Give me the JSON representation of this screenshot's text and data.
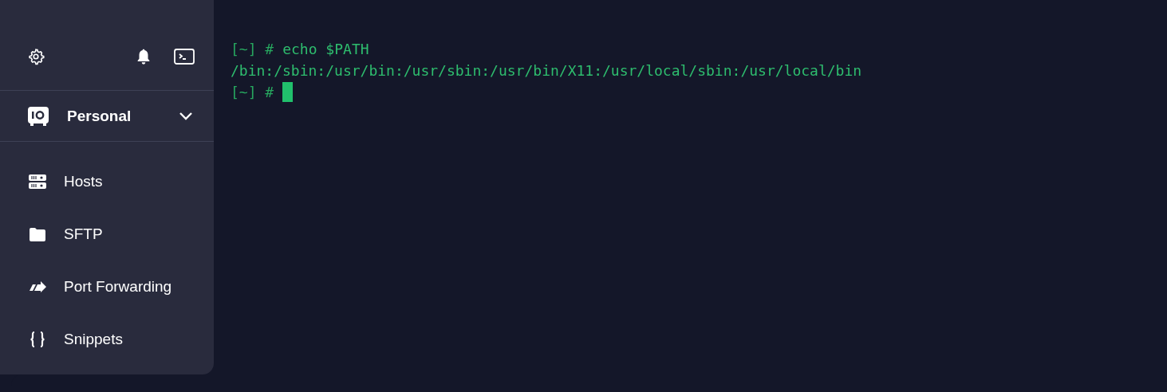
{
  "toolbar": {
    "icons": [
      {
        "kind": "settings"
      },
      {
        "kind": "bell"
      },
      {
        "kind": "terminal"
      }
    ]
  },
  "vault": {
    "label": "Personal",
    "expanded": false
  },
  "nav": [
    {
      "kind": "hosts",
      "label": "Hosts",
      "selected": false
    },
    {
      "kind": "sftp",
      "label": "SFTP",
      "selected": false
    },
    {
      "kind": "forward",
      "label": "Port Forwarding",
      "selected": false
    },
    {
      "kind": "snippets",
      "label": "Snippets",
      "selected": false
    }
  ],
  "terminal": {
    "lines": [
      {
        "prompt": "[~] #",
        "text": "echo $PATH"
      },
      {
        "text": "/bin:/sbin:/usr/bin:/usr/sbin:/usr/bin/X11:/usr/local/sbin:/usr/local/bin"
      },
      {
        "prompt": "[~] #",
        "cursor": true
      }
    ]
  }
}
